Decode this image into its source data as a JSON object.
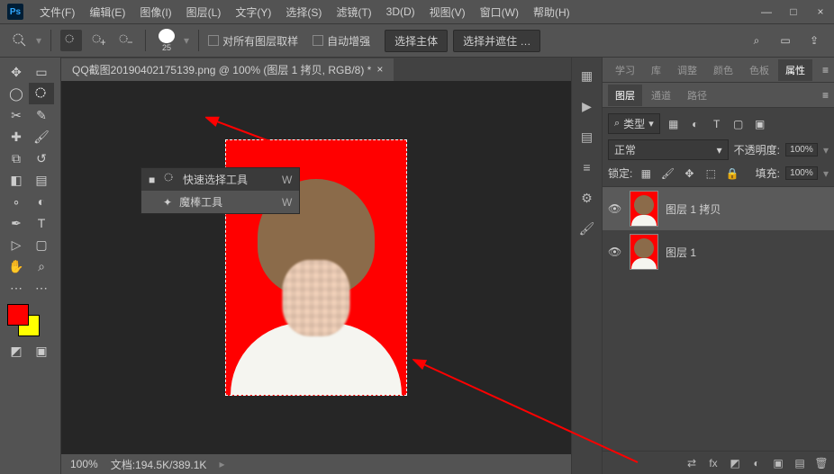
{
  "app_logo": "Ps",
  "menubar": {
    "items": [
      "文件(F)",
      "编辑(E)",
      "图像(I)",
      "图层(L)",
      "文字(Y)",
      "选择(S)",
      "滤镜(T)",
      "3D(D)",
      "视图(V)",
      "窗口(W)",
      "帮助(H)"
    ]
  },
  "window_controls": {
    "min": "—",
    "max": "□",
    "close": "×"
  },
  "options": {
    "brush_size": "25",
    "sample_all_layers": "对所有图层取样",
    "auto_enhance": "自动增强",
    "select_subject": "选择主体",
    "select_and_mask": "选择并遮住 …"
  },
  "document": {
    "tab_title": "QQ截图20190402175139.png @ 100% (图层 1 拷贝, RGB/8) *",
    "zoom": "100%",
    "status": "文档:194.5K/389.1K"
  },
  "tool_popup": {
    "items": [
      {
        "icon": "quick-select-icon",
        "label": "快速选择工具",
        "shortcut": "W",
        "selected": true
      },
      {
        "icon": "magic-wand-icon",
        "label": "魔棒工具",
        "shortcut": "W",
        "selected": false
      }
    ]
  },
  "mid_strip_icons": [
    "frames-icon",
    "play-icon",
    "swatch-icon",
    "list-icon",
    "adjust-icon",
    "brush-icon"
  ],
  "panels": {
    "top_tabs": [
      "学习",
      "库",
      "调整",
      "颜色",
      "色板",
      "属性"
    ],
    "top_active_index": 5,
    "layers_tabs": [
      "图层",
      "通道",
      "路径"
    ],
    "layers_active_index": 0,
    "filter_label": "类型",
    "blend_mode": "正常",
    "opacity_label": "不透明度:",
    "opacity_value": "100%",
    "lock_label": "锁定:",
    "fill_label": "填充:",
    "fill_value": "100%",
    "layers": [
      {
        "name": "图层 1 拷贝",
        "selected": true,
        "visible": true
      },
      {
        "name": "图层 1",
        "selected": false,
        "visible": true
      }
    ],
    "bottom_icons": [
      "link-icon",
      "fx-icon",
      "mask-icon",
      "adjustment-icon",
      "group-icon",
      "new-icon",
      "trash-icon"
    ]
  },
  "colors": {
    "foreground": "#ff0000",
    "background": "#ffff00"
  },
  "search_icon": "⌕"
}
